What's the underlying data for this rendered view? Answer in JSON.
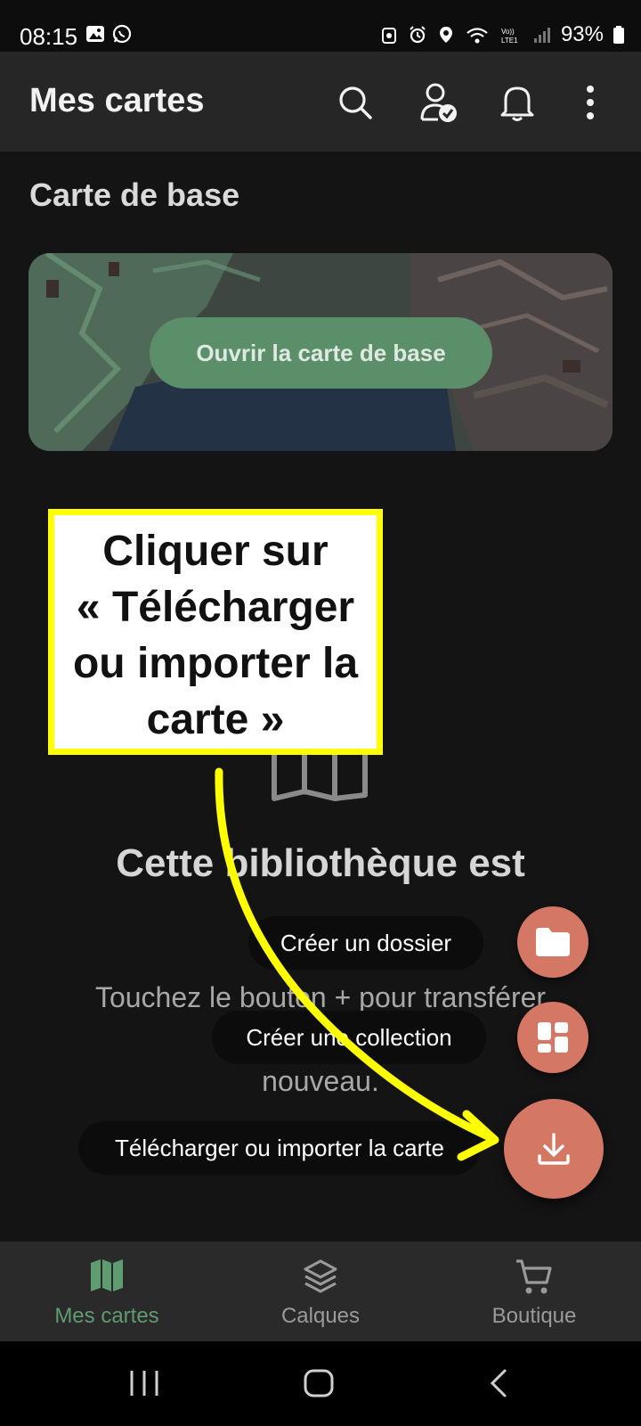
{
  "status_bar": {
    "time": "08:15",
    "battery": "93%"
  },
  "app_bar": {
    "title": "Mes cartes",
    "actions": [
      "search-icon",
      "account-verified-icon",
      "bell-icon",
      "more-vert-icon"
    ]
  },
  "base_map": {
    "section_title": "Carte de base",
    "open_button": "Ouvrir la carte de base"
  },
  "callout": {
    "line1": "Cliquer sur",
    "line2": "« Télécharger",
    "line3": "ou importer la",
    "line4": "carte »"
  },
  "empty_state": {
    "title": "Cette bibliothèque est",
    "description": "Touchez le bouton + pour transférer\ndes cartes                                   os\nnouveau."
  },
  "fab_menu": {
    "create_folder": "Créer un dossier",
    "create_collection": "Créer une collection",
    "download_import": "Télécharger ou importer la carte"
  },
  "bottom_nav": {
    "items": [
      {
        "label": "Mes cartes",
        "icon": "map-icon",
        "active": true
      },
      {
        "label": "Calques",
        "icon": "layers-icon",
        "active": false
      },
      {
        "label": "Boutique",
        "icon": "cart-icon",
        "active": false
      }
    ]
  },
  "colors": {
    "accent": "#5f9c70",
    "fab": "#d47764",
    "highlight": "#ffff00",
    "background": "#141414"
  }
}
